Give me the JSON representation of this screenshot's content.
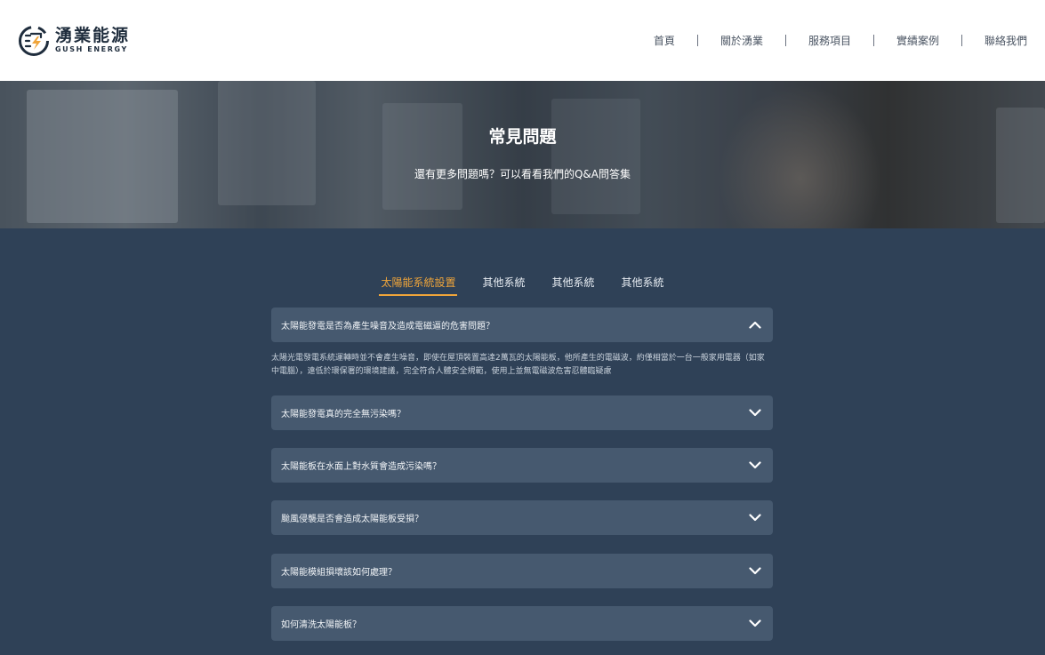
{
  "brand": {
    "name_zh": "湧業能源",
    "name_en": "GUSH ENERGY",
    "accent": "#f0a53a",
    "dark": "#1f2d3d"
  },
  "nav": {
    "items": [
      "首頁",
      "關於湧業",
      "服務項目",
      "實績案例",
      "聯絡我們"
    ]
  },
  "hero": {
    "title": "常見問題",
    "subtitle": "還有更多問題嗎？可以看看我們的Q&A問答集"
  },
  "tabs": [
    "太陽能系統設置",
    "其他系統",
    "其他系統",
    "其他系統"
  ],
  "active_tab": 0,
  "faq": [
    {
      "question": "太陽能發電是否為產生噪音及造成電磁逼的危害問題？",
      "answer": "太陽光電發電系統運轉時並不會產生噪音，即使在屋頂裝置高達2萬瓦的太陽能板，他所產生的電磁波，約僅相當於一台一般家用電器（如家中電腦），遠低於環保署的環境建議，完全符合人體安全規範，使用上並無電磁波危害忍體臨疑慮",
      "expanded": true,
      "icon": "chevron-up-icon"
    },
    {
      "question": "太陽能發電真的完全無污染嗎？",
      "expanded": false,
      "icon": "chevron-down-icon"
    },
    {
      "question": "太陽能板在水面上對水質會造成污染嗎？",
      "expanded": false,
      "icon": "chevron-down-icon"
    },
    {
      "question": "颱風侵襲是否會造成太陽能板受損？",
      "expanded": false,
      "icon": "chevron-down-icon"
    },
    {
      "question": "太陽能模組損壞該如何處理？",
      "expanded": false,
      "icon": "chevron-down-icon"
    },
    {
      "question": "如何清洗太陽能板？",
      "expanded": false,
      "icon": "chevron-down-icon"
    }
  ]
}
